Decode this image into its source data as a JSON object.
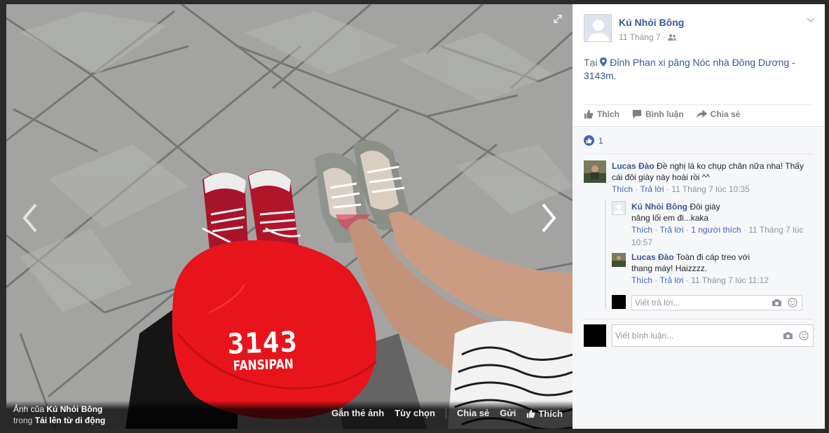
{
  "photo": {
    "owner_prefix": "Ảnh của ",
    "owner_name": "Kú Nhỏi Bông",
    "album_prefix": "trong ",
    "album_name": "Tải lên từ di động",
    "cap_text_main": "3143",
    "cap_text_sub": "FANSIPAN",
    "actions": [
      "Gắn thẻ ảnh",
      "Tùy chọn",
      "Chia sẻ",
      "Gửi",
      "Thích"
    ]
  },
  "post": {
    "author": "Kú Nhỏi Bông",
    "date": "11 Tháng 7",
    "location_prefix": "Tại ",
    "location_name": "Đỉnh Phan xi păng Nóc nhà Đông Dương - 3143m.",
    "actions": {
      "like": "Thích",
      "comment": "Bình luận",
      "share": "Chia sẻ"
    },
    "like_count": "1"
  },
  "comments": [
    {
      "name": "Lucas Đào",
      "text": "Đề nghị là ko chụp chân nữa nha! Thấy cái đôi giày này hoài rồi ^^",
      "like": "Thích",
      "reply": "Trả lời",
      "time": "11 Tháng 7 lúc 10:35"
    }
  ],
  "replies": [
    {
      "name": "Kú Nhỏi Bông",
      "text": "Đôi giày nâng lối em đi...kaka",
      "like": "Thích",
      "reply": "Trả lời",
      "likes_count": "1 người thích",
      "time": "11 Tháng 7 lúc 10:57"
    },
    {
      "name": "Lucas Đào",
      "text": "Toàn đi cáp treo với thang máy! Haizzzz.",
      "like": "Thích",
      "reply": "Trả lời",
      "time": "11 Tháng 7 lúc 11:12"
    }
  ],
  "reply_input": {
    "placeholder": "Viết trả lời..."
  },
  "comment_input": {
    "placeholder": "Viết bình luận..."
  },
  "colors": {
    "link": "#365899",
    "cap": "#e8141c",
    "shoe_red": "#c0162a"
  }
}
